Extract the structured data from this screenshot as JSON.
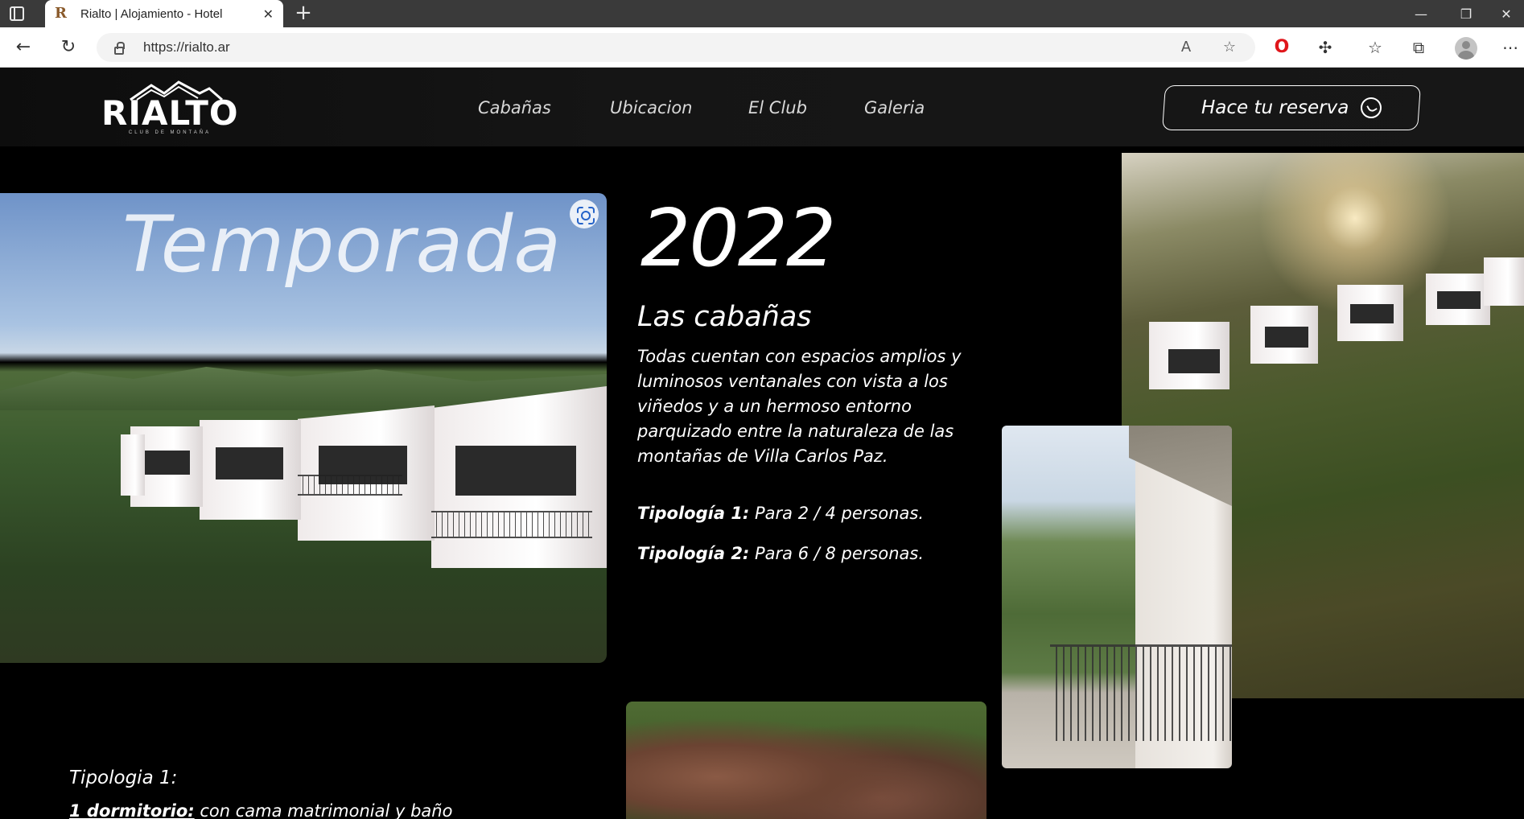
{
  "browser": {
    "tab_title": "Rialto | Alojamiento - Hotel",
    "tab_favicon": "R",
    "tab_close": "✕",
    "new_tab": "+",
    "url": "https://rialto.ar",
    "window_controls": {
      "minimize": "—",
      "restore": "❐",
      "close": "✕"
    },
    "icons": [
      "back-icon",
      "reload-icon",
      "lock-icon",
      "read-aloud-icon",
      "add-favorite-icon",
      "opera-icon",
      "extensions-icon",
      "favorites-icon",
      "collections-icon",
      "profile-icon",
      "menu-icon"
    ]
  },
  "site": {
    "logo": {
      "name": "RIALTO",
      "tagline": "CLUB DE MONTAÑA"
    },
    "nav": [
      "Cabañas",
      "Ubicacion",
      "El Club",
      "Galeria"
    ],
    "reserve_button": "Hace tu reserva",
    "hero": {
      "overlay_title": "Temporada",
      "year": "2022",
      "subtitle": "Las cabañas",
      "description": "Todas cuentan con espacios amplios y luminosos ventanales con vista a los viñedos y a un hermoso entorno parquizado entre la naturaleza de las montañas de Villa Carlos Paz.",
      "types": [
        {
          "label": "Tipología 1:",
          "value": " Para 2 / 4 personas."
        },
        {
          "label": "Tipología 2:",
          "value": " Para 6 / 8 personas."
        }
      ]
    },
    "details": {
      "heading": "Tipologia 1:",
      "line_label": "1 dormitorio:",
      "line_value": " con cama matrimonial y baño"
    }
  }
}
